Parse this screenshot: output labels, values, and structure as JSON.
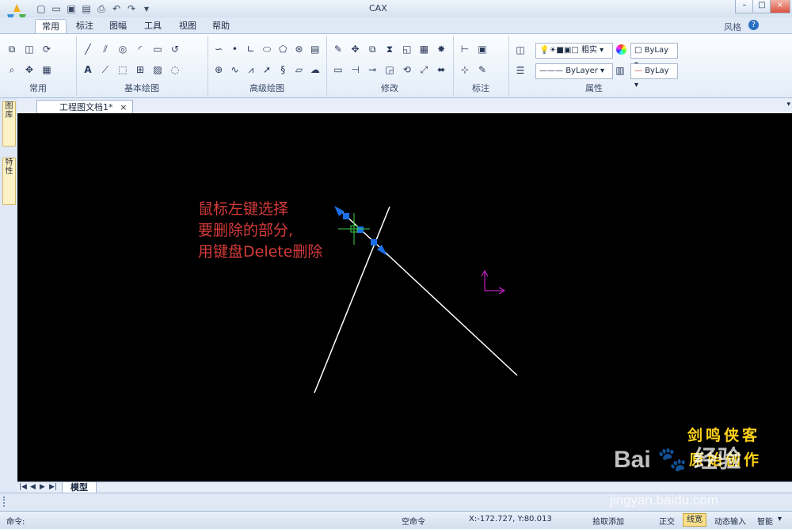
{
  "titlebar": {
    "title": "CAX",
    "controls": [
      "–",
      "□",
      "×"
    ],
    "qat_icons": [
      "new-icon",
      "open-icon",
      "save-icon",
      "save-as-icon",
      "print-icon",
      "undo-icon",
      "redo-icon"
    ]
  },
  "tabs": [
    {
      "label": "常用",
      "active": true
    },
    {
      "label": "标注"
    },
    {
      "label": "图幅"
    },
    {
      "label": "工具"
    },
    {
      "label": "视图"
    },
    {
      "label": "帮助"
    }
  ],
  "style_label": "风格",
  "ribbon": {
    "groups": [
      {
        "label": "常用"
      },
      {
        "label": "基本绘图"
      },
      {
        "label": "高级绘图"
      },
      {
        "label": "修改"
      },
      {
        "label": "标注"
      },
      {
        "label": "属性"
      }
    ],
    "properties": {
      "layer_combo": "粗实",
      "color_combo": "ByLay",
      "linetype_combo": "ByLayer",
      "lineweight_combo": "ByLay"
    }
  },
  "document": {
    "tab_label": "工程图文档1*",
    "close": "×"
  },
  "left_panel": {
    "btn1": "图库",
    "btn2": "特性"
  },
  "annotation": {
    "line1": "鼠标左键选择",
    "line2": "要删除的部分,",
    "line3": "用键盘Delete删除"
  },
  "watermark": {
    "line1": "剑鸣侠客",
    "line2": "原始创作",
    "brand": "Bai",
    "brand2": "经验",
    "url": "jingyan.baidu.com"
  },
  "layout": {
    "model_tab": "模型",
    "nav": [
      "|◀",
      "◀",
      "▶",
      "▶|"
    ]
  },
  "command": {
    "label": "命令:"
  },
  "status": {
    "command_state": "空命令",
    "coords": "X:-172.727, Y:80.013",
    "pick": "拾取添加",
    "ortho": "正交",
    "linewidth": "线宽",
    "dynamic_input": "动态输入",
    "smart": "智能"
  },
  "colors": {
    "annotation": "#d63b3b",
    "watermark": "#ffd31a",
    "canvas": "#000000",
    "ucs": "#c020c0",
    "grip": "#1a6fe8"
  }
}
